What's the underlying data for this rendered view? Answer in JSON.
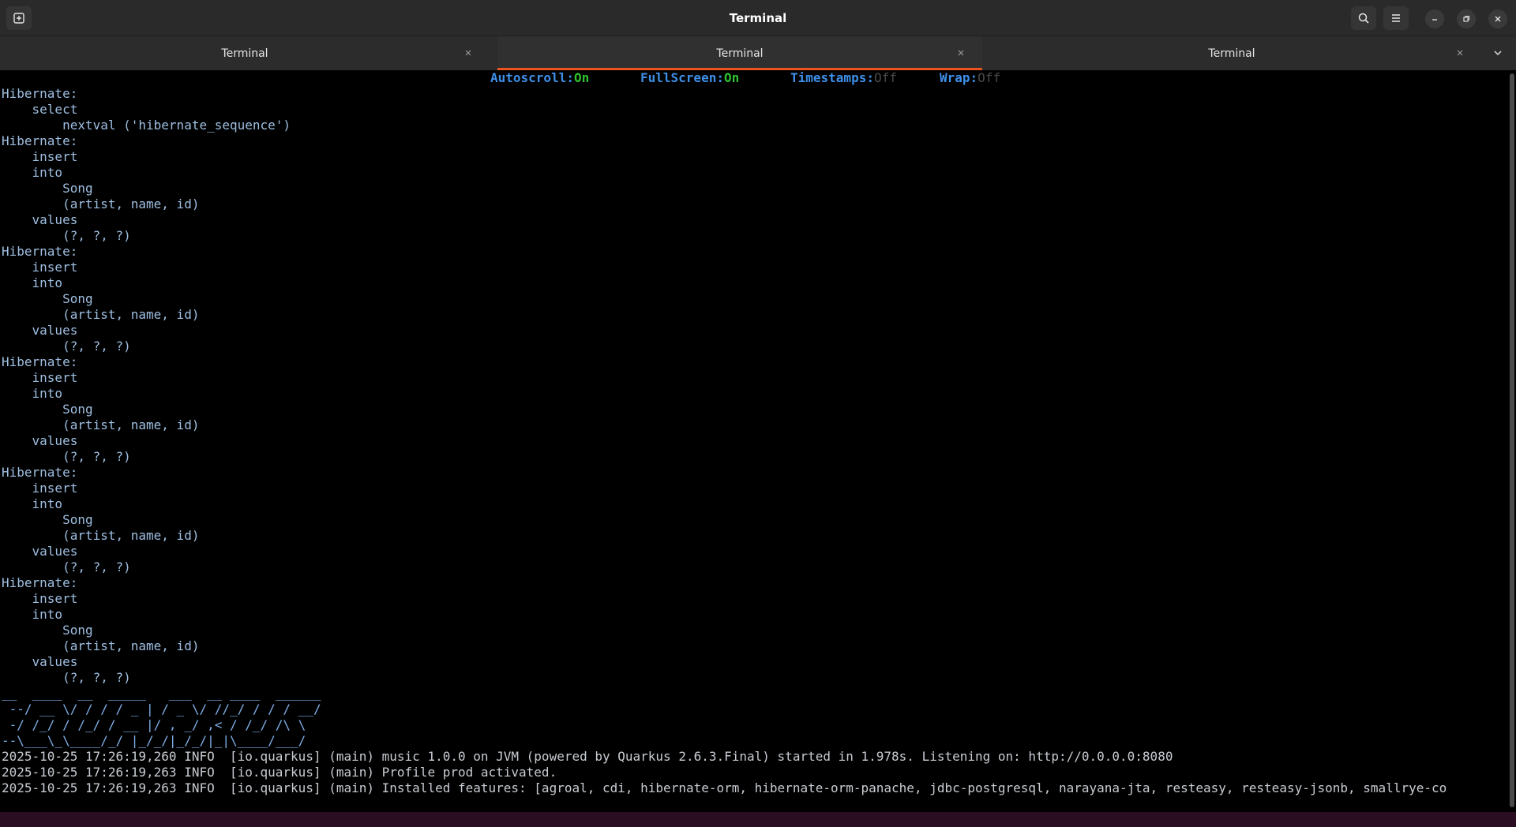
{
  "window": {
    "title": "Terminal",
    "new_tab_icon": "new-tab-icon",
    "search_icon": "search-icon",
    "menu_icon": "hamburger-menu-icon",
    "controls": [
      "minimize-icon",
      "restore-icon",
      "close-icon"
    ]
  },
  "tabs": [
    {
      "label": "Terminal",
      "active": false
    },
    {
      "label": "Terminal",
      "active": true
    },
    {
      "label": "Terminal",
      "active": false
    }
  ],
  "accent_color": "#e95420",
  "status": {
    "autoscroll_key": "Autoscroll:",
    "autoscroll_val": "On",
    "fullscreen_key": "FullScreen:",
    "fullscreen_val": "On",
    "timestamps_key": "Timestamps:",
    "timestamps_val": "Off",
    "wrap_key": "Wrap:",
    "wrap_val": "Off"
  },
  "log_lines": [
    "Hibernate: ",
    "    select",
    "        nextval ('hibernate_sequence')",
    "Hibernate: ",
    "    insert ",
    "    into",
    "        Song",
    "        (artist, name, id) ",
    "    values",
    "        (?, ?, ?)",
    "Hibernate: ",
    "    insert ",
    "    into",
    "        Song",
    "        (artist, name, id) ",
    "    values",
    "        (?, ?, ?)",
    "Hibernate: ",
    "    insert ",
    "    into",
    "        Song",
    "        (artist, name, id) ",
    "    values",
    "        (?, ?, ?)",
    "Hibernate: ",
    "    insert ",
    "    into",
    "        Song",
    "        (artist, name, id) ",
    "    values",
    "        (?, ?, ?)",
    "Hibernate: ",
    "    insert ",
    "    into",
    "        Song",
    "        (artist, name, id) ",
    "    values",
    "        (?, ?, ?)"
  ],
  "banner_lines": [
    "__  ____  __  _____   ___  __ ____  ______ ",
    " --/ __ \\/ / / / _ | / _ \\/ //_/ / / / __/ ",
    " -/ /_/ / /_/ / __ |/ , _/ ,< / /_/ /\\ \\   ",
    "--\\___\\_\\____/_/ |_/_/|_/_/|_|\\____/___/   "
  ],
  "info_lines": [
    "2025-10-25 17:26:19,260 INFO  [io.quarkus] (main) music 1.0.0 on JVM (powered by Quarkus 2.6.3.Final) started in 1.978s. Listening on: http://0.0.0.0:8080",
    "2025-10-25 17:26:19,263 INFO  [io.quarkus] (main) Profile prod activated. ",
    "2025-10-25 17:26:19,263 INFO  [io.quarkus] (main) Installed features: [agroal, cdi, hibernate-orm, hibernate-orm-panache, jdbc-postgresql, narayana-jta, resteasy, resteasy-jsonb, smallrye-co"
  ]
}
